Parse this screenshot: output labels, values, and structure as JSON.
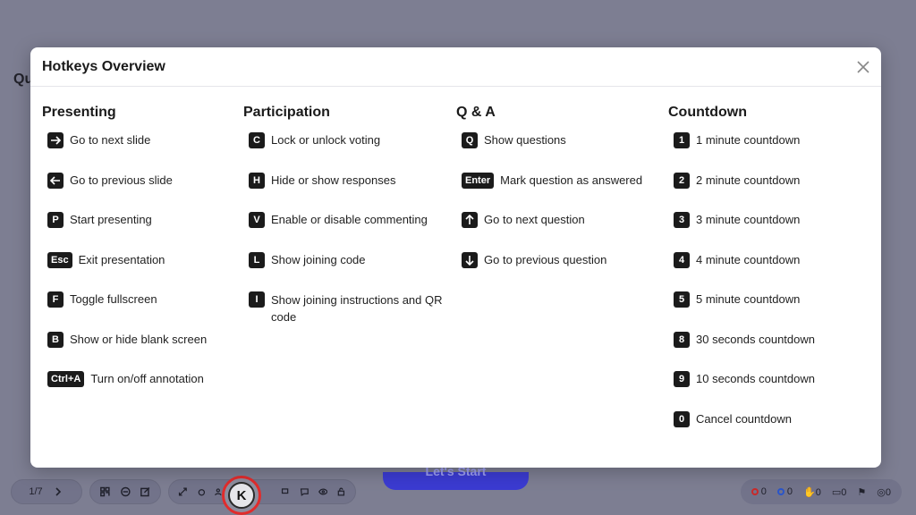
{
  "background": {
    "title_fragment": "Qu",
    "start_button": "Let's Start",
    "slide_counter": "1/7",
    "k_badge": "K",
    "status": {
      "red_count": "0",
      "blue_count": "0",
      "hands_count": "0",
      "chat_count": "0",
      "users_count": "0"
    }
  },
  "modal": {
    "title": "Hotkeys Overview",
    "columns": [
      {
        "title": "Presenting",
        "items": [
          {
            "key": "→",
            "icon": "arrow-right-icon",
            "label": "Go to next slide"
          },
          {
            "key": "←",
            "icon": "arrow-left-icon",
            "label": "Go to previous slide"
          },
          {
            "key": "P",
            "label": "Start presenting"
          },
          {
            "key": "Esc",
            "label": "Exit presentation"
          },
          {
            "key": "F",
            "label": "Toggle fullscreen"
          },
          {
            "key": "B",
            "label": "Show or hide blank screen"
          },
          {
            "key": "Ctrl+A",
            "label": "Turn on/off annotation"
          }
        ]
      },
      {
        "title": "Participation",
        "items": [
          {
            "key": "C",
            "label": "Lock or unlock voting"
          },
          {
            "key": "H",
            "label": "Hide or show responses"
          },
          {
            "key": "V",
            "label": "Enable or disable commenting"
          },
          {
            "key": "L",
            "label": "Show joining code"
          },
          {
            "key": "I",
            "label": "Show joining instructions and QR code"
          }
        ]
      },
      {
        "title": "Q & A",
        "items": [
          {
            "key": "Q",
            "label": "Show questions"
          },
          {
            "key": "Enter",
            "label": "Mark question as answered"
          },
          {
            "key": "↑",
            "icon": "arrow-up-icon",
            "label": "Go to next question"
          },
          {
            "key": "↓",
            "icon": "arrow-down-icon",
            "label": "Go to previous question"
          }
        ]
      },
      {
        "title": "Countdown",
        "items": [
          {
            "key": "1",
            "label": "1 minute countdown"
          },
          {
            "key": "2",
            "label": "2 minute countdown"
          },
          {
            "key": "3",
            "label": "3 minute countdown"
          },
          {
            "key": "4",
            "label": "4 minute countdown"
          },
          {
            "key": "5",
            "label": "5 minute countdown"
          },
          {
            "key": "8",
            "label": "30 seconds countdown"
          },
          {
            "key": "9",
            "label": "10 seconds countdown"
          },
          {
            "key": "0",
            "label": "Cancel countdown"
          }
        ]
      }
    ]
  }
}
